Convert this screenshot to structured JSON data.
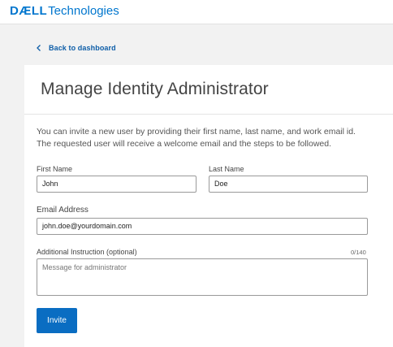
{
  "header": {
    "logo_dell": "DÆLL",
    "logo_tech": "Technologies",
    "brand_color": "#0076ce"
  },
  "nav": {
    "back_label": "Back to dashboard",
    "back_icon": "chevron-left-icon"
  },
  "page": {
    "title": "Manage Identity Administrator"
  },
  "form": {
    "intro": "You can invite a new user by providing their first name, last name, and work email id. The requested user will receive a welcome email and the steps to be followed.",
    "first_name": {
      "label": "First Name",
      "value": "John"
    },
    "last_name": {
      "label": "Last Name",
      "value": "Doe"
    },
    "email": {
      "label": "Email Address",
      "value": "john.doe@yourdomain.com"
    },
    "instruction": {
      "label": "Additional Instruction (optional)",
      "placeholder": "Message for administrator",
      "counter": "0/140"
    },
    "submit_label": "Invite",
    "submit_color": "#0a6dc2"
  }
}
